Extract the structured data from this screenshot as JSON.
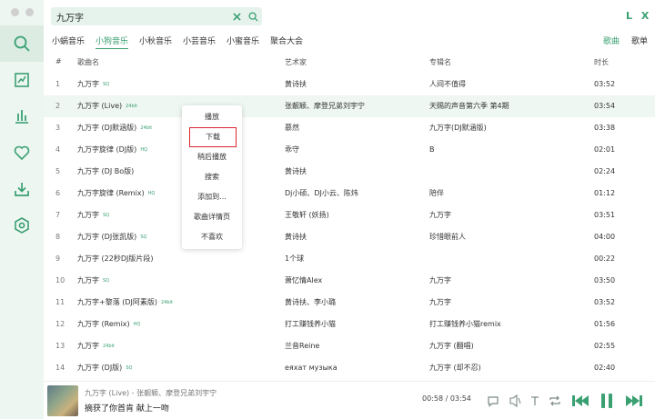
{
  "search": {
    "value": "九万字",
    "placeholder": ""
  },
  "logo": "L X",
  "source_tabs": [
    "小蜗音乐",
    "小狗音乐",
    "小秋音乐",
    "小芸音乐",
    "小蜜音乐",
    "聚合大会"
  ],
  "mode_tabs": [
    "歌曲",
    "歌单"
  ],
  "columns": {
    "index": "#",
    "name": "歌曲名",
    "artist": "艺术家",
    "album": "专辑名",
    "duration": "时长"
  },
  "songs": [
    {
      "index": "1",
      "name": "九万字",
      "badge": "SQ",
      "artist": "黄诗扶",
      "album": "人间不值得",
      "duration": "03:52"
    },
    {
      "index": "2",
      "name": "九万字 (Live)",
      "badge": "24bit",
      "artist": "张靓颖、摩登兄弟刘宇宁",
      "album": "天赐的声音第六季 第4期",
      "duration": "03:54"
    },
    {
      "index": "3",
      "name": "九万字 (DJ默涵版)",
      "badge": "24bit",
      "artist": "慕然",
      "album": "九万字(DJ默涵版)",
      "duration": "03:38"
    },
    {
      "index": "4",
      "name": "九万字旋律 (DJ版)",
      "badge": "HQ",
      "artist": "乖守",
      "album": "B",
      "duration": "02:01"
    },
    {
      "index": "5",
      "name": "九万字 (DJ Bo版)",
      "badge": "",
      "artist": "黄诗扶",
      "album": "",
      "duration": "02:24"
    },
    {
      "index": "6",
      "name": "九万字旋律 (Remix)",
      "badge": "HQ",
      "artist": "Dj小硕、DJ小云、陈炜",
      "album": "陪伴",
      "duration": "01:12"
    },
    {
      "index": "7",
      "name": "九万字",
      "badge": "SQ",
      "artist": "王敬轩 (妖扬)",
      "album": "九万字",
      "duration": "03:51"
    },
    {
      "index": "8",
      "name": "九万字 (DJ张凯版)",
      "badge": "SQ",
      "artist": "黄诗扶",
      "album": "珍惜眼前人",
      "duration": "04:00"
    },
    {
      "index": "9",
      "name": "九万字 (22秒DJ版片段)",
      "badge": "",
      "artist": "1个球",
      "album": "",
      "duration": "00:22"
    },
    {
      "index": "10",
      "name": "九万字",
      "badge": "SQ",
      "artist": "萧忆情Alex",
      "album": "九万字",
      "duration": "03:50"
    },
    {
      "index": "11",
      "name": "九万字+黎落 (DJ阿素版)",
      "badge": "24bit",
      "artist": "黄诗扶、李小璐",
      "album": "九万字",
      "duration": "03:52"
    },
    {
      "index": "12",
      "name": "九万字 (Remix)",
      "badge": "HQ",
      "artist": "打工赚钱养小猫",
      "album": "打工赚钱养小猫remix",
      "duration": "01:56"
    },
    {
      "index": "13",
      "name": "九万字",
      "badge": "24bit",
      "artist": "兰音Reine",
      "album": "九万字 (翻唱)",
      "duration": "02:55"
    },
    {
      "index": "14",
      "name": "九万字 (DJ版)",
      "badge": "SQ",
      "artist": "еяхат музыка",
      "album": "九万字 (却不忍)",
      "duration": "02:40"
    }
  ],
  "context_menu": [
    "播放",
    "下载",
    "稍后播放",
    "搜索",
    "添加到...",
    "歌曲详情页",
    "不喜欢"
  ],
  "player": {
    "title": "九万字 (Live) - 张靓颖、摩登兄弟刘宇宁",
    "lyric": "摘获了你首肯 献上一吻",
    "time": "00:58 / 03:54"
  },
  "colors": {
    "accent": "#3aa072",
    "sidebar_bg": "#edf6f1",
    "highlight": "#d9272e"
  },
  "icons": [
    "search-icon",
    "chart-icon",
    "list-icon",
    "heart-icon",
    "download-icon",
    "settings-icon",
    "clear-icon",
    "comment-icon",
    "lyric-icon",
    "repeat-icon",
    "prev-icon",
    "pause-icon",
    "next-icon"
  ]
}
